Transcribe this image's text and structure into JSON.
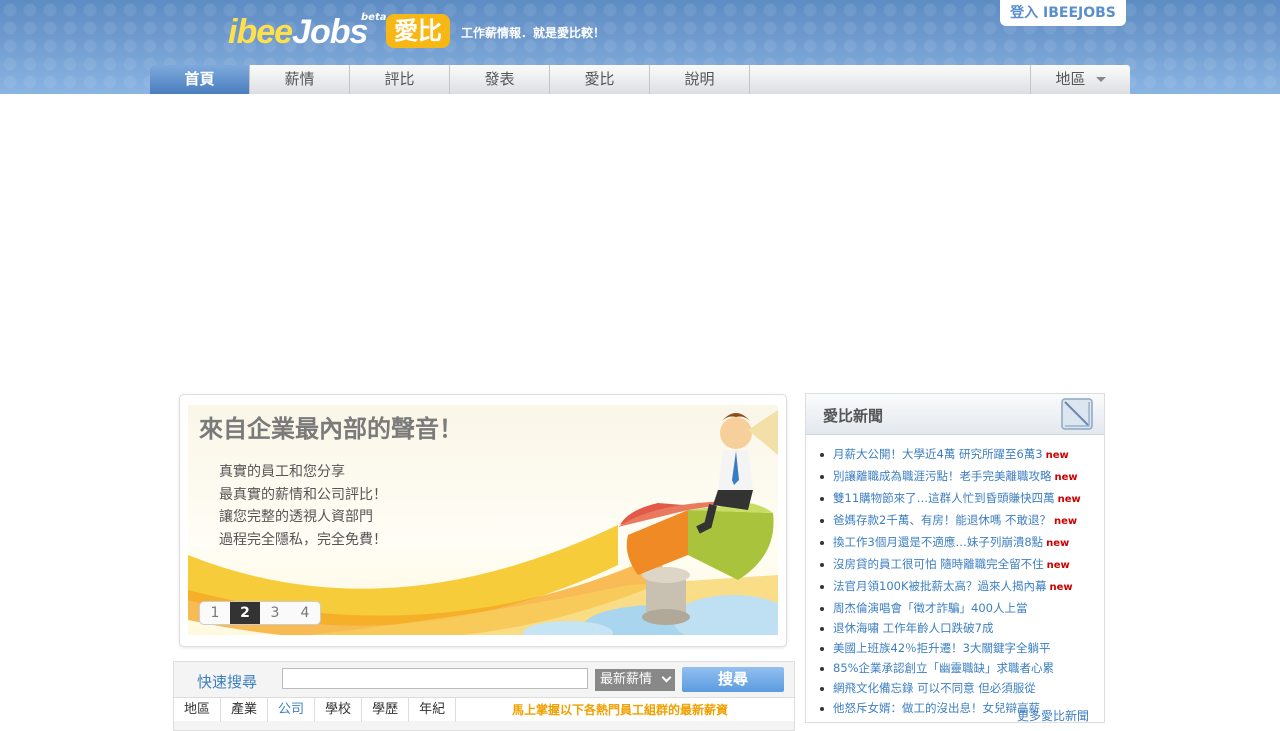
{
  "header": {
    "logo_ibee": "ibee",
    "logo_jobs": "Jobs",
    "logo_beta": "beta",
    "logo_aibi": "愛比",
    "tagline": "工作薪情報．就是愛比較！",
    "login": "登入 IBEEJOBS"
  },
  "nav": {
    "tabs": [
      {
        "label": "首頁"
      },
      {
        "label": "薪情"
      },
      {
        "label": "評比"
      },
      {
        "label": "發表"
      },
      {
        "label": "愛比"
      },
      {
        "label": "說明"
      }
    ],
    "region": "地區"
  },
  "banner": {
    "title": "來自企業最內部的聲音！",
    "lines": [
      "真實的員工和您分享",
      "最真實的薪情和公司評比！",
      "讓您完整的透視人資部門",
      "過程完全隱私，完全免費！"
    ],
    "slides": [
      "1",
      "2",
      "3",
      "4"
    ],
    "active_slide": 2
  },
  "news": {
    "title": "愛比新聞",
    "new_label": "new",
    "items": [
      {
        "text": "月薪大公開！大學近4萬 研究所躍至6萬3",
        "new": true
      },
      {
        "text": "別讓離職成為職涯污點！老手完美離職攻略",
        "new": true
      },
      {
        "text": "雙11購物節來了…這群人忙到昏頭賺快四萬",
        "new": true
      },
      {
        "text": "爸媽存款2千萬、有房！能退休嗎 不敢退？",
        "new": true
      },
      {
        "text": "換工作3個月還是不適應…妹子列崩潰8點",
        "new": true
      },
      {
        "text": "沒房貸的員工很可怕 隨時離職完全留不住",
        "new": true
      },
      {
        "text": "法官月領100K被批薪太高？過來人揭內幕",
        "new": true
      },
      {
        "text": "周杰倫演唱會「徵才詐騙」400人上當",
        "new": false
      },
      {
        "text": "退休海嘯 工作年齡人口跌破7成",
        "new": false
      },
      {
        "text": "美國上班族42％拒升遷！3大關鍵字全躺平",
        "new": false
      },
      {
        "text": "85%企業承認創立「幽靈職缺」求職者心累",
        "new": false
      },
      {
        "text": "網飛文化備忘錄 可以不同意 但必須服從",
        "new": false
      },
      {
        "text": "他怒斥女婿：做工的沒出息！女兒辯高薪",
        "new": false
      }
    ],
    "more": "更多愛比新聞"
  },
  "quick_search": {
    "label": "快速搜尋",
    "input_value": "",
    "select_value": "最新薪情",
    "button": "搜尋",
    "filters": [
      {
        "label": "地區"
      },
      {
        "label": "產業"
      },
      {
        "label": "公司"
      },
      {
        "label": "學校"
      },
      {
        "label": "學歷"
      },
      {
        "label": "年紀"
      }
    ],
    "active_filter": 2,
    "hint": "馬上掌握以下各熱門員工組群的最新薪資"
  },
  "colors": {
    "header_blue": "#6f9ace",
    "link_blue": "#3d7fc1",
    "brand_yellow": "#f7b714",
    "new_red": "#cc0000",
    "hint_orange": "#f0a000"
  }
}
